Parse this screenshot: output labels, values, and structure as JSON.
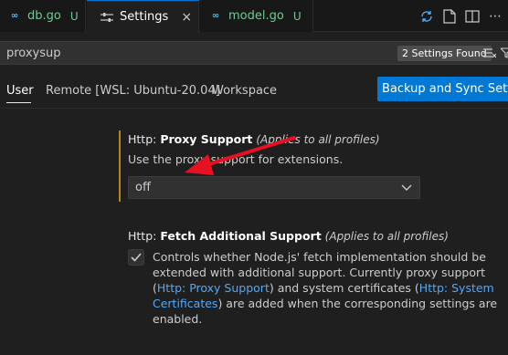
{
  "tabs": {
    "db": {
      "name": "db.go",
      "status": "U"
    },
    "settings": {
      "name": "Settings",
      "close": "×"
    },
    "model": {
      "name": "model.go",
      "status": "U"
    }
  },
  "search": {
    "value": "proxysup",
    "found": "2 Settings Found"
  },
  "scopes": {
    "user": "User",
    "remote": "Remote [WSL: Ubuntu-20.04]",
    "workspace": "Workspace",
    "sync_button": "Backup and Sync Settings"
  },
  "proxy_support": {
    "category": "Http: ",
    "name": "Proxy Support",
    "scope_note": "(Applies to all profiles)",
    "description": "Use the proxy support for extensions.",
    "selected": "off"
  },
  "fetch_support": {
    "category": "Http: ",
    "name": "Fetch Additional Support",
    "scope_note": "(Applies to all profiles)",
    "checked": true,
    "desc_part1": "Controls whether Node.js' fetch implementation should be extended with additional support. Currently proxy support (",
    "link1": "Http: Proxy Support",
    "desc_part2": ") and system certificates (",
    "link2": "Http: System Certificates",
    "desc_part3": ") are added when the corresponding settings are enabled."
  },
  "colors": {
    "accent": "#0078d4",
    "untracked": "#73c991",
    "link": "#4daafc",
    "annotation_arrow": "#e81123"
  }
}
